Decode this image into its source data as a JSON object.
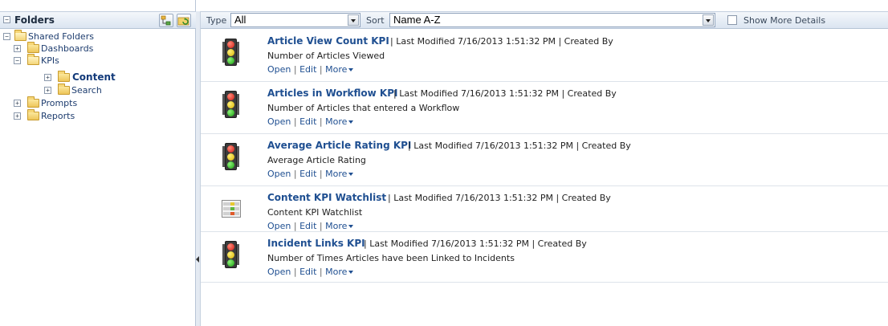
{
  "sidebar": {
    "title": "Folders",
    "tree": {
      "shared_folders": "Shared Folders",
      "dashboards": "Dashboards",
      "kpis": "KPIs",
      "content": "Content",
      "search": "Search",
      "prompts": "Prompts",
      "reports": "Reports"
    },
    "toggles": {
      "collapse": "−",
      "expand": "+"
    }
  },
  "toolbar": {
    "type_label": "Type",
    "type_value": "All",
    "sort_label": "Sort",
    "sort_value": "Name A-Z",
    "show_more_details_label": "Show More Details",
    "show_more_details_checked": false
  },
  "items": [
    {
      "title": "Article View Count KPI",
      "meta": "| Last Modified 7/16/2013 1:51:32 PM | Created By",
      "description": "Number of Articles Viewed",
      "actions": {
        "open": "Open",
        "edit": "Edit",
        "more": "More"
      },
      "icon": "traffic-light-icon"
    },
    {
      "title": "Articles in Workflow KPI",
      "meta": "| Last Modified 7/16/2013 1:51:32 PM | Created By",
      "description": "Number of Articles that entered a Workflow",
      "actions": {
        "open": "Open",
        "edit": "Edit",
        "more": "More"
      },
      "icon": "traffic-light-icon"
    },
    {
      "title": "Average Article Rating KPI",
      "meta": "| Last Modified 7/16/2013 1:51:32 PM | Created By",
      "description": "Average Article Rating",
      "actions": {
        "open": "Open",
        "edit": "Edit",
        "more": "More"
      },
      "icon": "traffic-light-icon"
    },
    {
      "title": "Content KPI Watchlist",
      "meta": "| Last Modified 7/16/2013 1:51:32 PM | Created By",
      "description": "Content KPI Watchlist",
      "actions": {
        "open": "Open",
        "edit": "Edit",
        "more": "More"
      },
      "icon": "watchlist-icon"
    },
    {
      "title": "Incident Links KPI",
      "meta": "| Last Modified 7/16/2013 1:51:32 PM | Created By",
      "description": "Number of Times Articles have been Linked to Incidents",
      "actions": {
        "open": "Open",
        "edit": "Edit",
        "more": "More"
      },
      "icon": "traffic-light-icon"
    }
  ],
  "action_separator": "|",
  "colors": {
    "link": "#1f4f91",
    "header_gradient_top": "#f4f7fb",
    "header_gradient_bottom": "#dbe5f1",
    "border": "#b6c4d6"
  }
}
